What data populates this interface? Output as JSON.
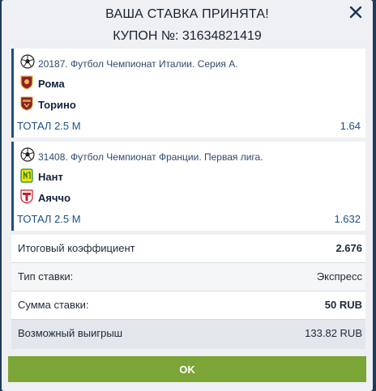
{
  "modal": {
    "title": "ВАША СТАВКА ПРИНЯТА!",
    "coupon_label": "КУПОН №: 31634821419",
    "close_icon": "close-icon"
  },
  "bets": [
    {
      "league": "20187. Футбол Чемпионат Италии. Серия А.",
      "home": "Рома",
      "away": "Торино",
      "market": "ТОТАЛ 2.5 М",
      "odd": "1.64"
    },
    {
      "league": "31408. Футбол Чемпионат Франции. Первая лига.",
      "home": "Нант",
      "away": "Аяччо",
      "market": "ТОТАЛ 2.5 М",
      "odd": "1.632"
    }
  ],
  "summary": {
    "total_coef_label": "Итоговый коэффициент",
    "total_coef_value": "2.676",
    "bet_type_label": "Тип ставки:",
    "bet_type_value": "Экспресс",
    "stake_label": "Сумма ставки:",
    "stake_value": "50 RUB",
    "win_label": "Возможный выигрыш",
    "win_value": "133.82 RUB"
  },
  "ok_button": "OK",
  "colors": {
    "accent": "#1b4f8a",
    "ok": "#7ba537",
    "backdrop": "#1f3a5b"
  }
}
